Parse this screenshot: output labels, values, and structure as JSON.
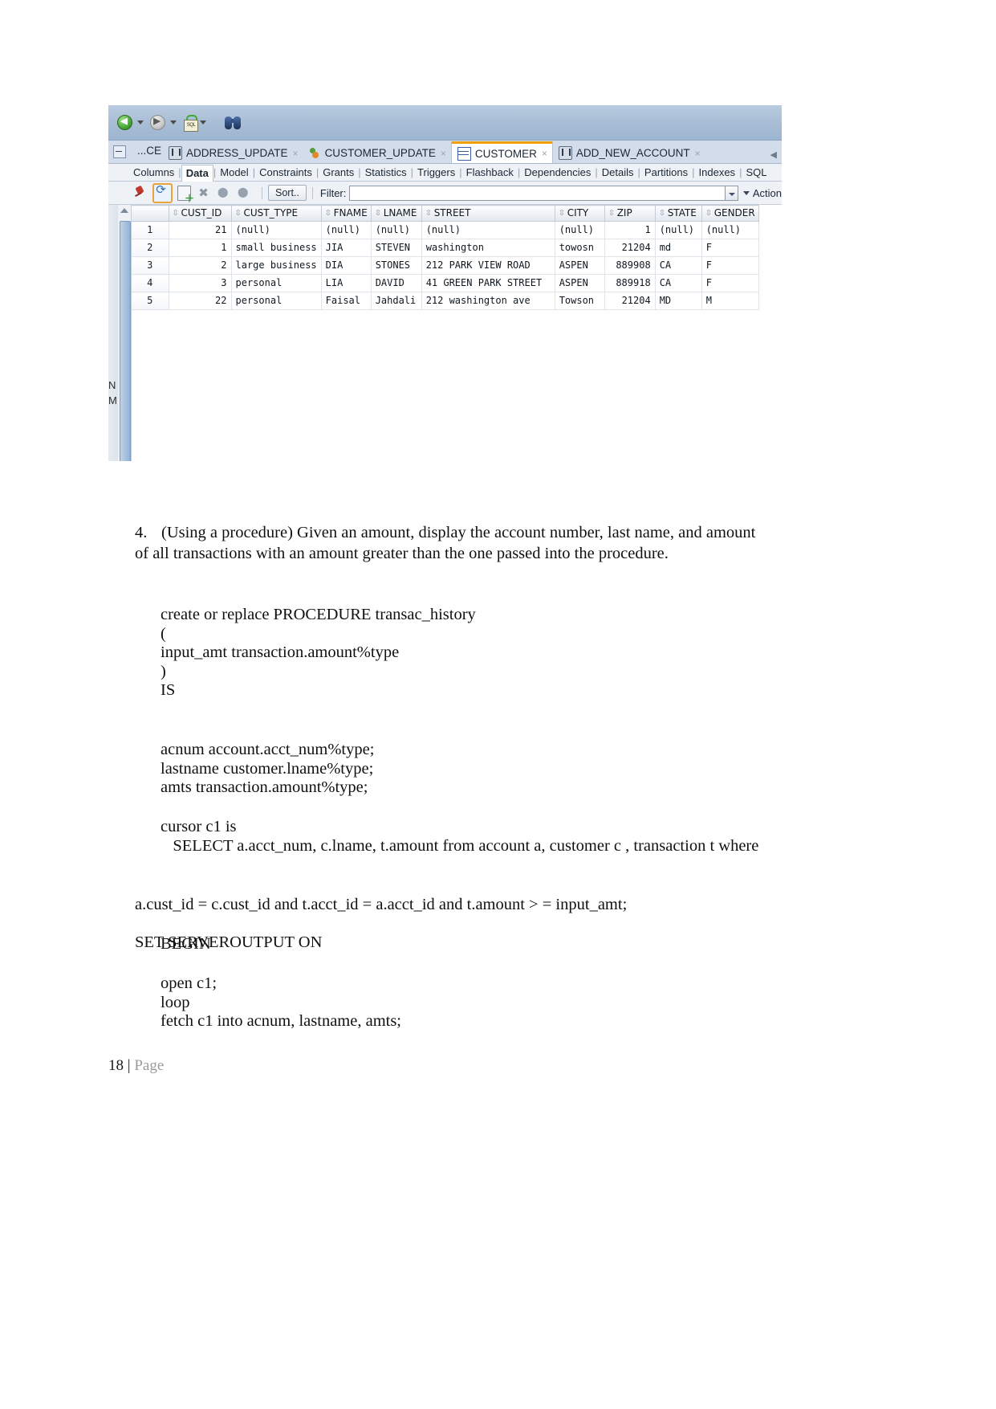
{
  "app": {
    "toolbar": {
      "back_icon": "back-arrow-icon",
      "forward_icon": "forward-arrow-icon",
      "sql_icon": "run-sql-icon",
      "sql_label": "SQL",
      "find_icon": "binoculars-icon"
    },
    "tabs": {
      "overflow_label": "...CE",
      "items": [
        {
          "label": "ADDRESS_UPDATE",
          "icon": "procedure-icon",
          "active": false
        },
        {
          "label": "CUSTOMER_UPDATE",
          "icon": "function-icon",
          "active": false
        },
        {
          "label": "CUSTOMER",
          "icon": "table-icon",
          "active": true
        },
        {
          "label": "ADD_NEW_ACCOUNT",
          "icon": "procedure-icon",
          "active": false
        }
      ],
      "close_glyph": "×"
    },
    "subtabs": [
      "Columns",
      "Data",
      "Model",
      "Constraints",
      "Grants",
      "Statistics",
      "Triggers",
      "Flashback",
      "Dependencies",
      "Details",
      "Partitions",
      "Indexes",
      "SQL"
    ],
    "subtab_active": "Data",
    "grid_toolbar": {
      "icons": [
        "freeze-pin-icon",
        "refresh-icon",
        "insert-row-icon",
        "delete-row-icon",
        "commit-icon",
        "rollback-icon"
      ],
      "sort_label": "Sort..",
      "filter_label": "Filter:",
      "filter_value": "",
      "filter_placeholder": "",
      "actions_label": "Action"
    },
    "grid": {
      "row_header": "",
      "columns": [
        "CUST_ID",
        "CUST_TYPE",
        "FNAME",
        "LNAME",
        "STREET",
        "CITY",
        "ZIP",
        "STATE",
        "GENDER"
      ],
      "rows": [
        {
          "n": "1",
          "cells": [
            "21",
            "(null)",
            "(null)",
            "(null)",
            "(null)",
            "(null)",
            "1",
            "(null)",
            "(null)"
          ]
        },
        {
          "n": "2",
          "cells": [
            "1",
            "small business",
            "JIA",
            "STEVEN",
            "washington",
            "towosn",
            "21204",
            "md",
            "F"
          ]
        },
        {
          "n": "3",
          "cells": [
            "2",
            "large business",
            "DIA",
            "STONES",
            "212 PARK VIEW ROAD",
            "ASPEN",
            "889908",
            "CA",
            "F"
          ]
        },
        {
          "n": "4",
          "cells": [
            "3",
            "personal",
            "LIA",
            "DAVID",
            "41  GREEN PARK STREET",
            "ASPEN",
            "889918",
            "CA",
            "F"
          ]
        },
        {
          "n": "5",
          "cells": [
            "22",
            "personal",
            "Faisal",
            "Jahdali",
            "212 washington ave",
            "Towson",
            "21204",
            "MD",
            "M"
          ]
        }
      ]
    },
    "margin_text": [
      "N",
      "M"
    ]
  },
  "document": {
    "question": {
      "number": "4.",
      "text": "(Using a procedure) Given an amount, display the account number, last name, and amount of all transactions with an amount greater than the one passed into the procedure."
    },
    "code_1": "create or replace PROCEDURE transac_history\n(\ninput_amt transaction.amount%type\n)\nIS",
    "code_2": "acnum account.acct_num%type;\nlastname customer.lname%type;\namts transaction.amount%type;",
    "code_3": "cursor c1 is\n   SELECT a.acct_num, c.lname, t.amount from account a, customer c , transaction t where",
    "code_4": "a.cust_id = c.cust_id and t.acct_id = a.acct_id and t.amount > = input_amt;\n\nSET SERVEROUTPUT ON",
    "code_5": "BEGIN",
    "code_6": "open c1;\nloop\nfetch c1 into acnum, lastname, amts;",
    "footer": {
      "page_number": "18 |",
      "page_word": "Page"
    }
  }
}
